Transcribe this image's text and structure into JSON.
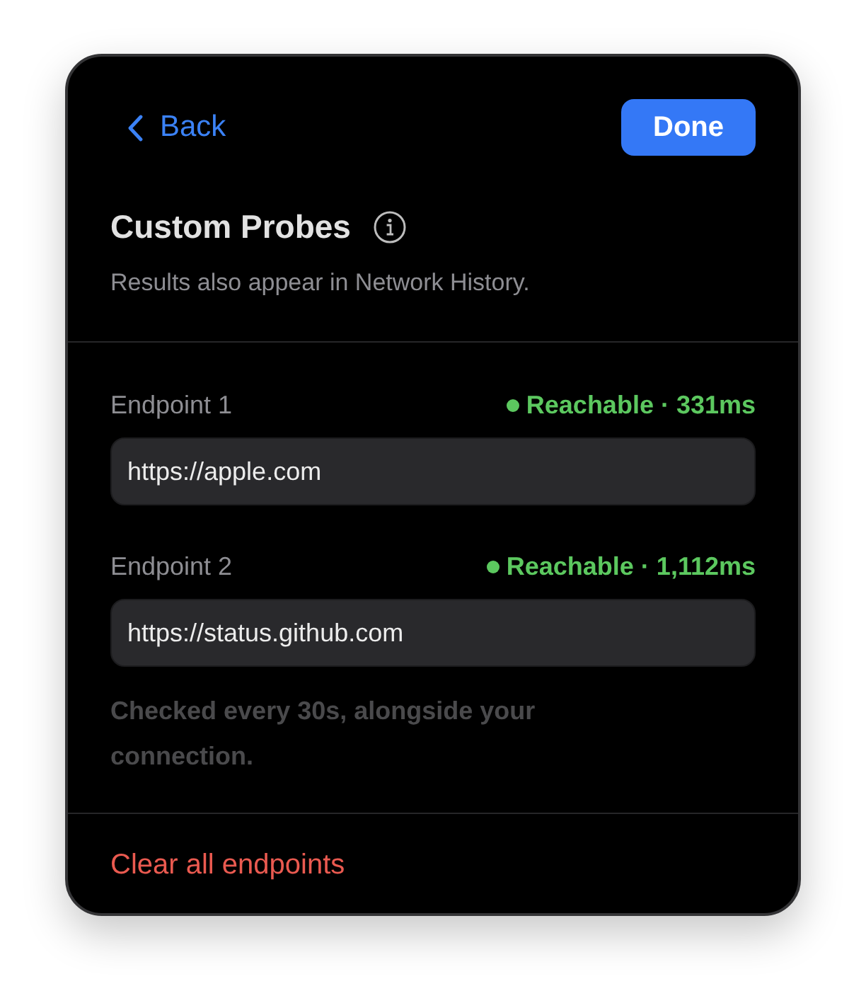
{
  "header": {
    "back": "Back",
    "done": "Done"
  },
  "title": "Custom Probes",
  "subtitle": "Results also appear in Network History.",
  "endpoints": [
    {
      "label": "Endpoint 1",
      "reachable": true,
      "status": "Reachable · 331ms",
      "value": "https://apple.com"
    },
    {
      "label": "Endpoint 2",
      "reachable": true,
      "status": "Reachable · 1,112ms",
      "value": "https://status.github.com"
    }
  ],
  "footnote": "Checked every 30s, alongside your connection.",
  "clear_action": "Clear all endpoints"
}
